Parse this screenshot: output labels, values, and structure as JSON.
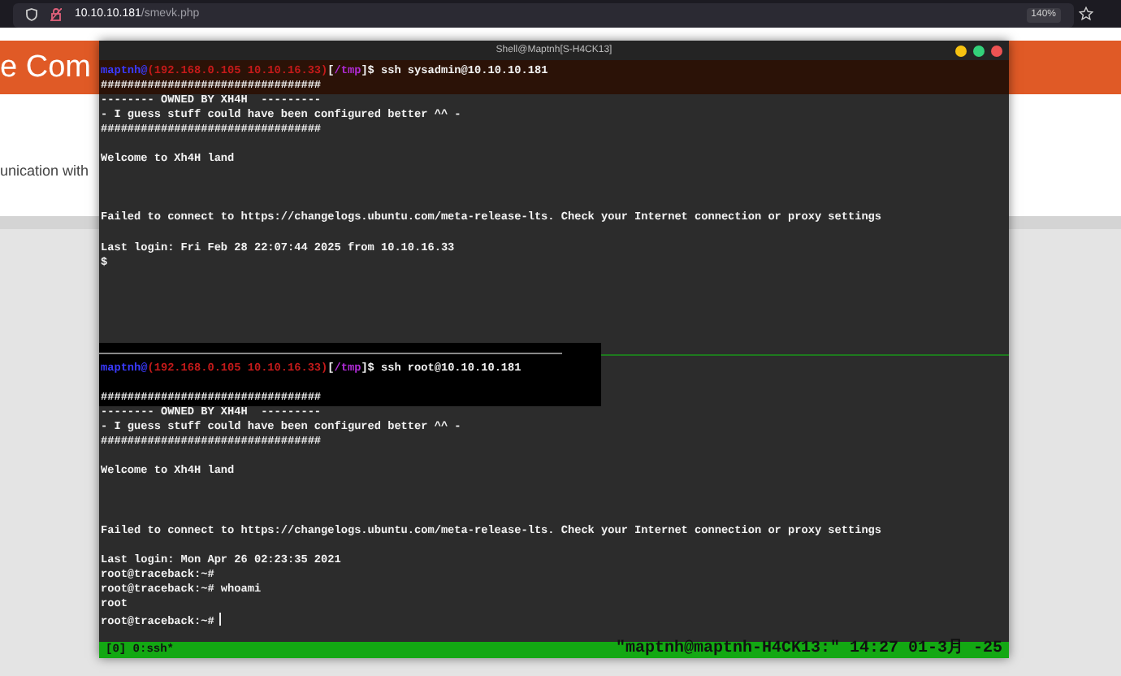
{
  "browser": {
    "url_host": "10.10.10.181",
    "url_path": "/smevk.php",
    "zoom": "140%"
  },
  "page": {
    "banner_text": "e Com",
    "body_text": "unication with"
  },
  "terminal": {
    "title": "Shell@Maptnh[S-H4CK13]",
    "panes": [
      {
        "lines": [
          {
            "kind": "prompt",
            "user": "maptnh@",
            "host": "(192.168.0.105 10.10.16.33)",
            "open": "[",
            "dir": "/tmp",
            "rest": "]$ ssh sysadmin@10.10.10.181"
          },
          {
            "kind": "text",
            "text": "#################################"
          },
          {
            "kind": "text",
            "text": "-------- OWNED BY XH4H  ---------"
          },
          {
            "kind": "text",
            "text": "- I guess stuff could have been configured better ^^ -"
          },
          {
            "kind": "text",
            "text": "#################################"
          },
          {
            "kind": "blank"
          },
          {
            "kind": "text",
            "text": "Welcome to Xh4H land"
          },
          {
            "kind": "blank"
          },
          {
            "kind": "blank"
          },
          {
            "kind": "blank"
          },
          {
            "kind": "text",
            "text": "Failed to connect to https://changelogs.ubuntu.com/meta-release-lts. Check your Internet connection or proxy settings"
          },
          {
            "kind": "blank"
          },
          {
            "kind": "text",
            "text": "Last login: Fri Feb 28 22:07:44 2025 from 10.10.16.33"
          },
          {
            "kind": "text",
            "text": "$"
          }
        ]
      },
      {
        "lines": [
          {
            "kind": "prompt",
            "user": "maptnh@",
            "host": "(192.168.0.105 10.10.16.33)",
            "open": "[",
            "dir": "/tmp",
            "rest": "]$ ssh root@10.10.10.181"
          },
          {
            "kind": "blank"
          },
          {
            "kind": "text",
            "text": "#################################"
          },
          {
            "kind": "text",
            "text": "-------- OWNED BY XH4H  ---------"
          },
          {
            "kind": "text",
            "text": "- I guess stuff could have been configured better ^^ -"
          },
          {
            "kind": "text",
            "text": "#################################"
          },
          {
            "kind": "blank"
          },
          {
            "kind": "text",
            "text": "Welcome to Xh4H land"
          },
          {
            "kind": "blank"
          },
          {
            "kind": "blank"
          },
          {
            "kind": "blank"
          },
          {
            "kind": "text",
            "text": "Failed to connect to https://changelogs.ubuntu.com/meta-release-lts. Check your Internet connection or proxy settings"
          },
          {
            "kind": "blank"
          },
          {
            "kind": "text",
            "text": "Last login: Mon Apr 26 02:23:35 2021"
          },
          {
            "kind": "text",
            "text": "root@traceback:~#"
          },
          {
            "kind": "text",
            "text": "root@traceback:~# whoami"
          },
          {
            "kind": "text",
            "text": "root"
          },
          {
            "kind": "text",
            "text": "root@traceback:~#",
            "cursor": true
          }
        ]
      }
    ],
    "status_left": "[0] 0:ssh*",
    "status_right": "\"maptnh@maptnh-H4CK13:\" 14:27 01-3月 -25"
  }
}
